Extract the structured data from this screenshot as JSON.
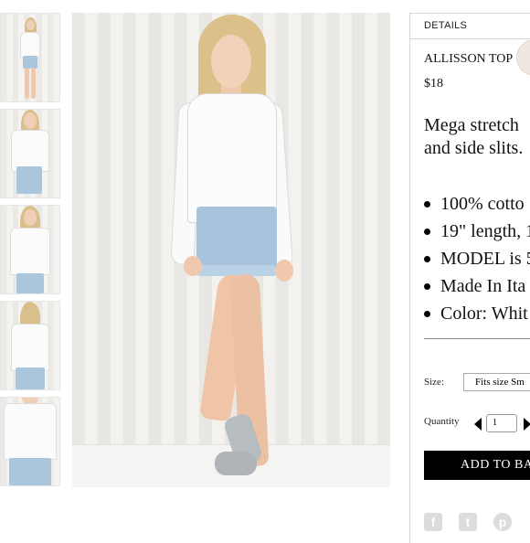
{
  "thumbnails": [
    {
      "name": "thumbnail-1"
    },
    {
      "name": "thumbnail-2"
    },
    {
      "name": "thumbnail-3"
    },
    {
      "name": "thumbnail-4"
    },
    {
      "name": "thumbnail-5"
    }
  ],
  "details": {
    "header": "DETAILS",
    "product_name": "ALLISSON TOP",
    "price": "$18",
    "description_line1": "Mega stretch",
    "description_line2": "and side slits.",
    "features": [
      "100% cotto",
      "19\" length, 1",
      "MODEL is 5",
      "Made In Ita",
      "Color: Whit"
    ],
    "size_label": "Size:",
    "size_value": "Fits size Sm",
    "quantity_label": "Quantity",
    "quantity_value": "1",
    "add_button": "ADD TO BAG",
    "social_icons": [
      "facebook-icon",
      "twitter-icon",
      "pinterest-icon"
    ]
  },
  "colors": {
    "button_bg": "#000000",
    "button_text": "#ffffff",
    "border": "#d8d8d8"
  }
}
